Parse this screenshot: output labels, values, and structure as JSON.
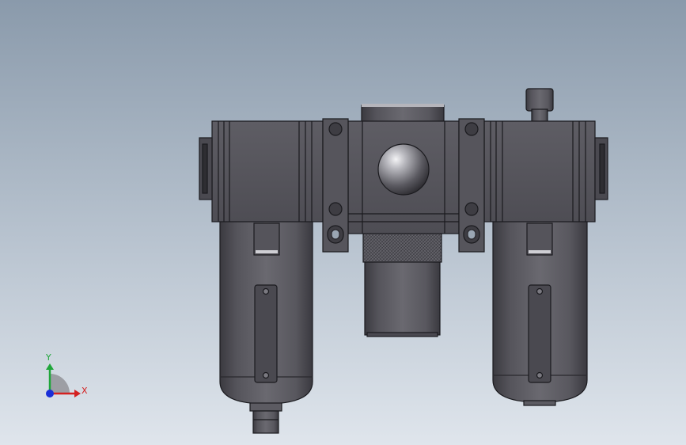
{
  "scene": {
    "background_top": "#8a9aab",
    "background_bottom": "#dfe5ec",
    "body_color": "#5c5b62",
    "edge_color": "#1a1a1e"
  },
  "triad": {
    "x_label": "X",
    "y_label": "Y",
    "x_color": "#d42020",
    "y_color": "#1fa63a",
    "z_color": "#1a2fd8"
  }
}
